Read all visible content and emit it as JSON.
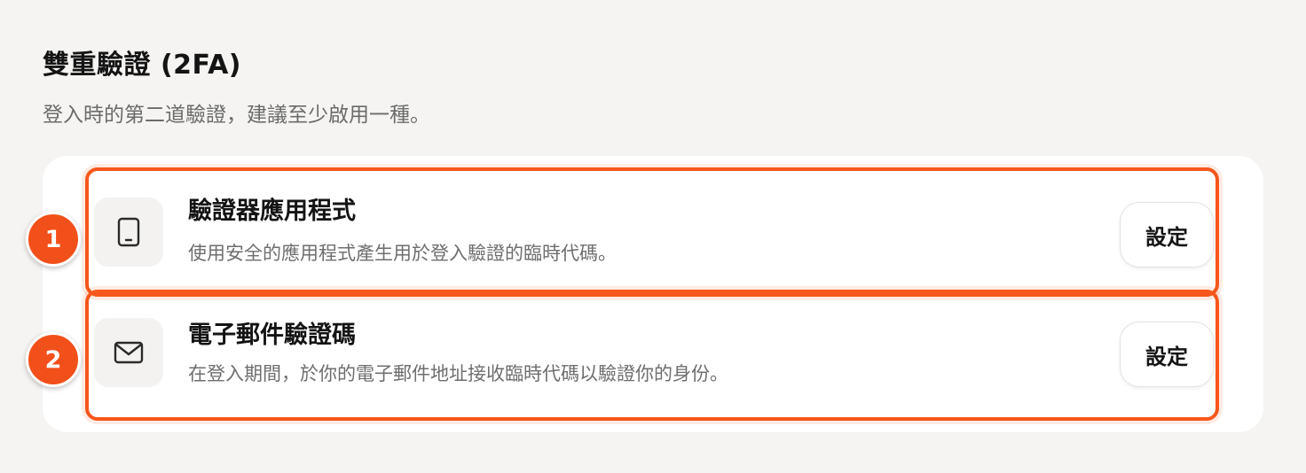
{
  "section": {
    "title": "雙重驗證 (2FA)",
    "description": "登入時的第二道驗證，建議至少啟用一種。"
  },
  "methods": [
    {
      "icon": "phone-icon",
      "title": "驗證器應用程式",
      "description": "使用安全的應用程式產生用於登入驗證的臨時代碼。",
      "button_label": "設定"
    },
    {
      "icon": "mail-icon",
      "title": "電子郵件驗證碼",
      "description": "在登入期間，於你的電子郵件地址接收臨時代碼以驗證你的身份。",
      "button_label": "設定"
    }
  ],
  "annotations": {
    "badges": [
      "1",
      "2"
    ],
    "highlight_color": "#f7571c",
    "badge_color": "#f2501a"
  }
}
